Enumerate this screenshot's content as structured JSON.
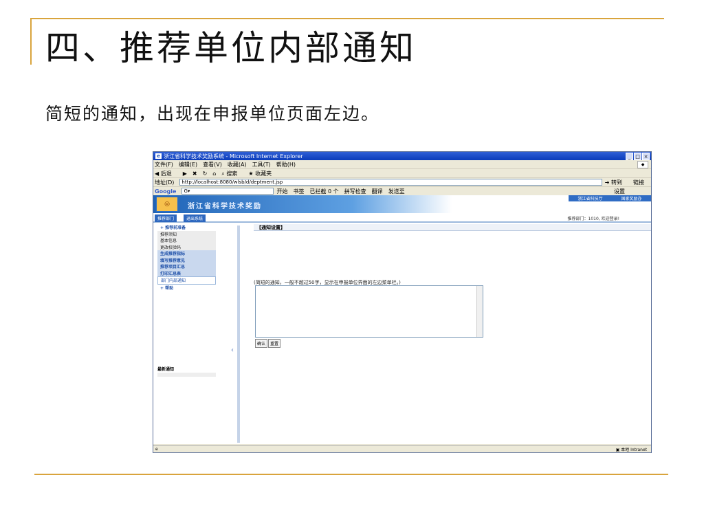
{
  "slide": {
    "title": "四、推荐单位内部通知",
    "subtitle": "简短的通知，出现在申报单位页面左边。"
  },
  "browser": {
    "window_title": "浙江省科学技术奖励系统 - Microsoft Internet Explorer",
    "menu": [
      "文件(F)",
      "编辑(E)",
      "查看(V)",
      "收藏(A)",
      "工具(T)",
      "帮助(H)"
    ],
    "toolbar": [
      "后退",
      "搜索",
      "收藏夹"
    ],
    "address_label": "地址(D)",
    "address": "http://localhost:8080/wlsb/d/deptment.jsp",
    "go_label": "转到",
    "links_label": "链接",
    "google_bar": [
      "开始",
      "书签",
      "已拦截 0 个",
      "拼写检查",
      "翻译",
      "发送至"
    ],
    "google_settings": "设置",
    "status_zone": "本地 Intranet"
  },
  "site": {
    "name": "浙江省科学技术奖励",
    "top_links": [
      "浙江省科技厅",
      "国家奖励办"
    ],
    "tabs": [
      "推荐部门",
      "退出系统"
    ],
    "welcome": "推荐部门：1010, 欢迎登录!",
    "sidebar": [
      "+ 推荐前准备",
      "推荐须知",
      "基本信息",
      "更改校验码",
      "生成推荐指标",
      "填写推荐意见",
      "推荐项目汇总",
      "打印汇总表",
      "部门内部通知",
      "+ 帮助"
    ],
    "news_title": "最新通知",
    "panel_title": "【通知设置】",
    "hint": "(简短的通知，一般不超过50字，显示在申报单位界面的左边菜单栏。)",
    "confirm": "确认",
    "reset": "重置"
  }
}
